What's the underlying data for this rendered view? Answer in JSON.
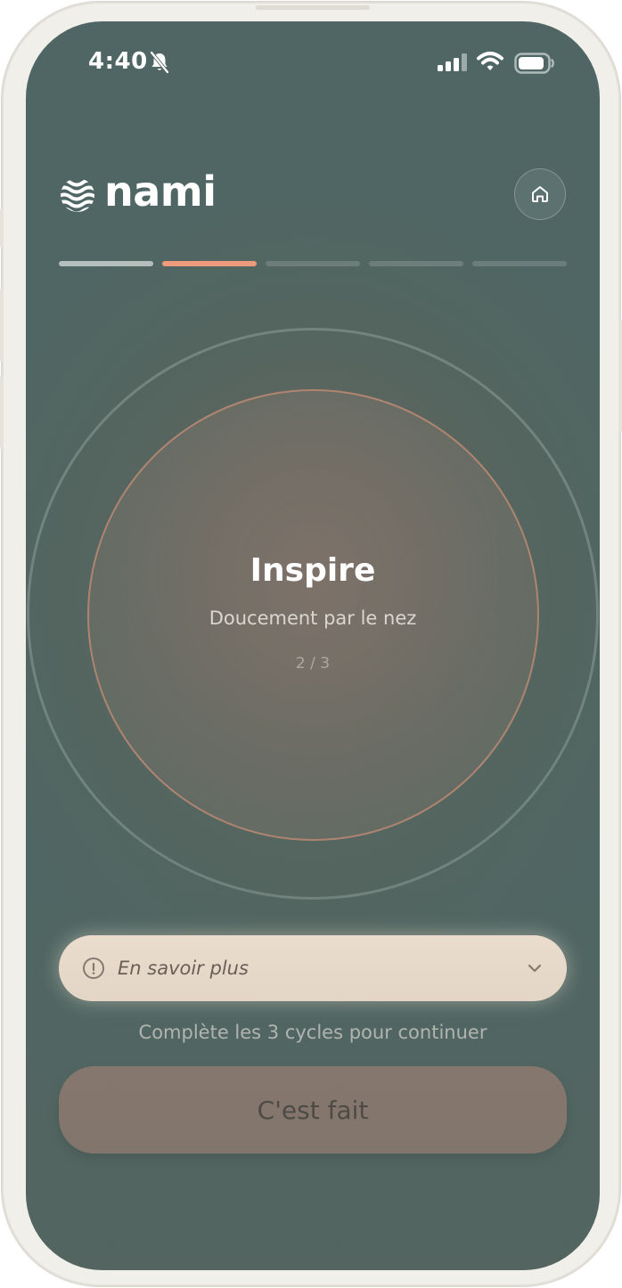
{
  "status_bar": {
    "time": "4:40"
  },
  "header": {
    "logo_text": "nami",
    "home_icon": "home-icon"
  },
  "progress": {
    "segments": 5,
    "current_step": 2,
    "completed_steps": 1
  },
  "breathing": {
    "phase_title": "Inspire",
    "phase_subtitle": "Doucement par le nez",
    "cycle_counter": "2 / 3"
  },
  "learn_more": {
    "label": "En savoir plus",
    "icon": "info-icon",
    "expand_icon": "chevron-down-icon"
  },
  "hint": {
    "text": "Complète les 3 cycles pour continuer"
  },
  "primary_action": {
    "label": "C'est fait"
  },
  "colors": {
    "background": "#55655f",
    "accent": "#ee9b7d",
    "card": "#f8e8d7",
    "button": "#8f7c72"
  }
}
